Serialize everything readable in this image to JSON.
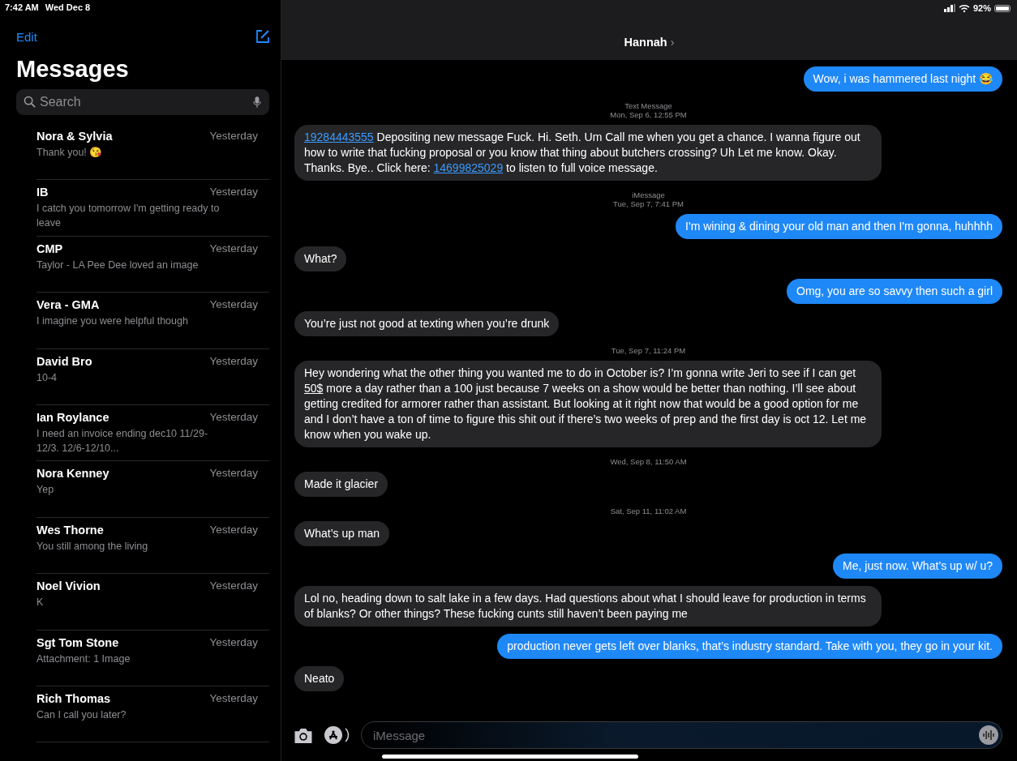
{
  "status_bar": {
    "time": "7:42 AM",
    "date": "Wed Dec 8",
    "battery": "92%"
  },
  "sidebar": {
    "edit": "Edit",
    "title": "Messages",
    "search": {
      "placeholder": "Search"
    },
    "conversations": [
      {
        "name": "Nora & Sylvia",
        "time": "Yesterday",
        "preview": "Thank you! 😘"
      },
      {
        "name": "IB",
        "time": "Yesterday",
        "preview": "I catch you tomorrow I'm getting ready to leave"
      },
      {
        "name": "CMP",
        "time": "Yesterday",
        "preview": "Taylor - LA Pee Dee loved an image"
      },
      {
        "name": "Vera - GMA",
        "time": "Yesterday",
        "preview": "I imagine you were helpful though"
      },
      {
        "name": "David Bro",
        "time": "Yesterday",
        "preview": "10-4"
      },
      {
        "name": "Ian Roylance",
        "time": "Yesterday",
        "preview": "I need an invoice ending dec10 11/29-12/3. 12/6-12/10..."
      },
      {
        "name": "Nora Kenney",
        "time": "Yesterday",
        "preview": "Yep"
      },
      {
        "name": "Wes Thorne",
        "time": "Yesterday",
        "preview": "You still among the living"
      },
      {
        "name": "Noel Vivion",
        "time": "Yesterday",
        "preview": "K"
      },
      {
        "name": "Sgt Tom Stone",
        "time": "Yesterday",
        "preview": "Attachment: 1 Image"
      },
      {
        "name": "Rich Thomas",
        "time": "Yesterday",
        "preview": "Can I call you later?"
      }
    ]
  },
  "chat": {
    "contact": "Hannah",
    "chevron": "›",
    "messages": [
      {
        "kind": "sent",
        "parts": [
          {
            "kind": "plain",
            "text": "Wow, i was hammered last night 😂"
          }
        ]
      },
      {
        "kind": "timestamp",
        "lines": [
          "Text Message",
          "Mon, Sep 6, 12:55 PM"
        ]
      },
      {
        "kind": "received",
        "parts": [
          {
            "kind": "link",
            "text": "19284443555"
          },
          {
            "kind": "plain",
            "text": " Depositing new message Fuck. Hi. Seth. Um Call me when you get a chance. I wanna figure out how to write that fucking proposal or you know that thing about butchers crossing? Uh Let me know. Okay. Thanks. Bye.. Click here: "
          },
          {
            "kind": "link",
            "text": "14699825029"
          },
          {
            "kind": "plain",
            "text": " to listen to full voice message."
          }
        ]
      },
      {
        "kind": "timestamp",
        "lines": [
          "iMessage",
          "Tue, Sep 7, 7:41 PM"
        ]
      },
      {
        "kind": "sent",
        "parts": [
          {
            "kind": "plain",
            "text": "I'm wining & dining your old man and then I'm gonna, huhhhh"
          }
        ]
      },
      {
        "kind": "received",
        "parts": [
          {
            "kind": "plain",
            "text": "What?"
          }
        ]
      },
      {
        "kind": "sent",
        "parts": [
          {
            "kind": "plain",
            "text": "Omg, you are so savvy then such a girl"
          }
        ]
      },
      {
        "kind": "received",
        "parts": [
          {
            "kind": "plain",
            "text": "You’re just not good at texting when you’re drunk"
          }
        ]
      },
      {
        "kind": "timestamp",
        "lines": [
          "Tue, Sep 7, 11:24 PM"
        ]
      },
      {
        "kind": "received",
        "parts": [
          {
            "kind": "plain",
            "text": "Hey wondering what the other thing you wanted me to do in October is? I’m gonna write Jeri to see if I can get "
          },
          {
            "kind": "detected",
            "text": "50$"
          },
          {
            "kind": "plain",
            "text": " more a day rather than a 100 just because 7 weeks on a show would be better than nothing. I’ll see about getting credited for armorer rather than assistant. But looking at it right now that would be a good option for me and I don’t have a ton of time to figure this shit out if there’s two weeks of prep and the first day is oct 12. Let me know when you wake up."
          }
        ]
      },
      {
        "kind": "timestamp",
        "lines": [
          "Wed, Sep 8, 11:50 AM"
        ]
      },
      {
        "kind": "received",
        "parts": [
          {
            "kind": "plain",
            "text": "Made it glacier"
          }
        ]
      },
      {
        "kind": "timestamp",
        "lines": [
          "Sat, Sep 11, 11:02 AM"
        ]
      },
      {
        "kind": "received",
        "parts": [
          {
            "kind": "plain",
            "text": "What’s up man"
          }
        ]
      },
      {
        "kind": "sent",
        "parts": [
          {
            "kind": "plain",
            "text": "Me, just now. What’s up w/ u?"
          }
        ]
      },
      {
        "kind": "received",
        "parts": [
          {
            "kind": "plain",
            "text": "Lol no, heading down to salt lake in a few days. Had questions about what I should leave for production in terms of blanks? Or other things? These fucking cunts still haven’t been paying me"
          }
        ]
      },
      {
        "kind": "sent",
        "parts": [
          {
            "kind": "plain",
            "text": "production never gets left over blanks, that’s industry standard. Take with you, they go in your kit."
          }
        ]
      },
      {
        "kind": "received",
        "parts": [
          {
            "kind": "plain",
            "text": "Neato"
          }
        ]
      }
    ],
    "input": {
      "placeholder": "iMessage"
    }
  }
}
